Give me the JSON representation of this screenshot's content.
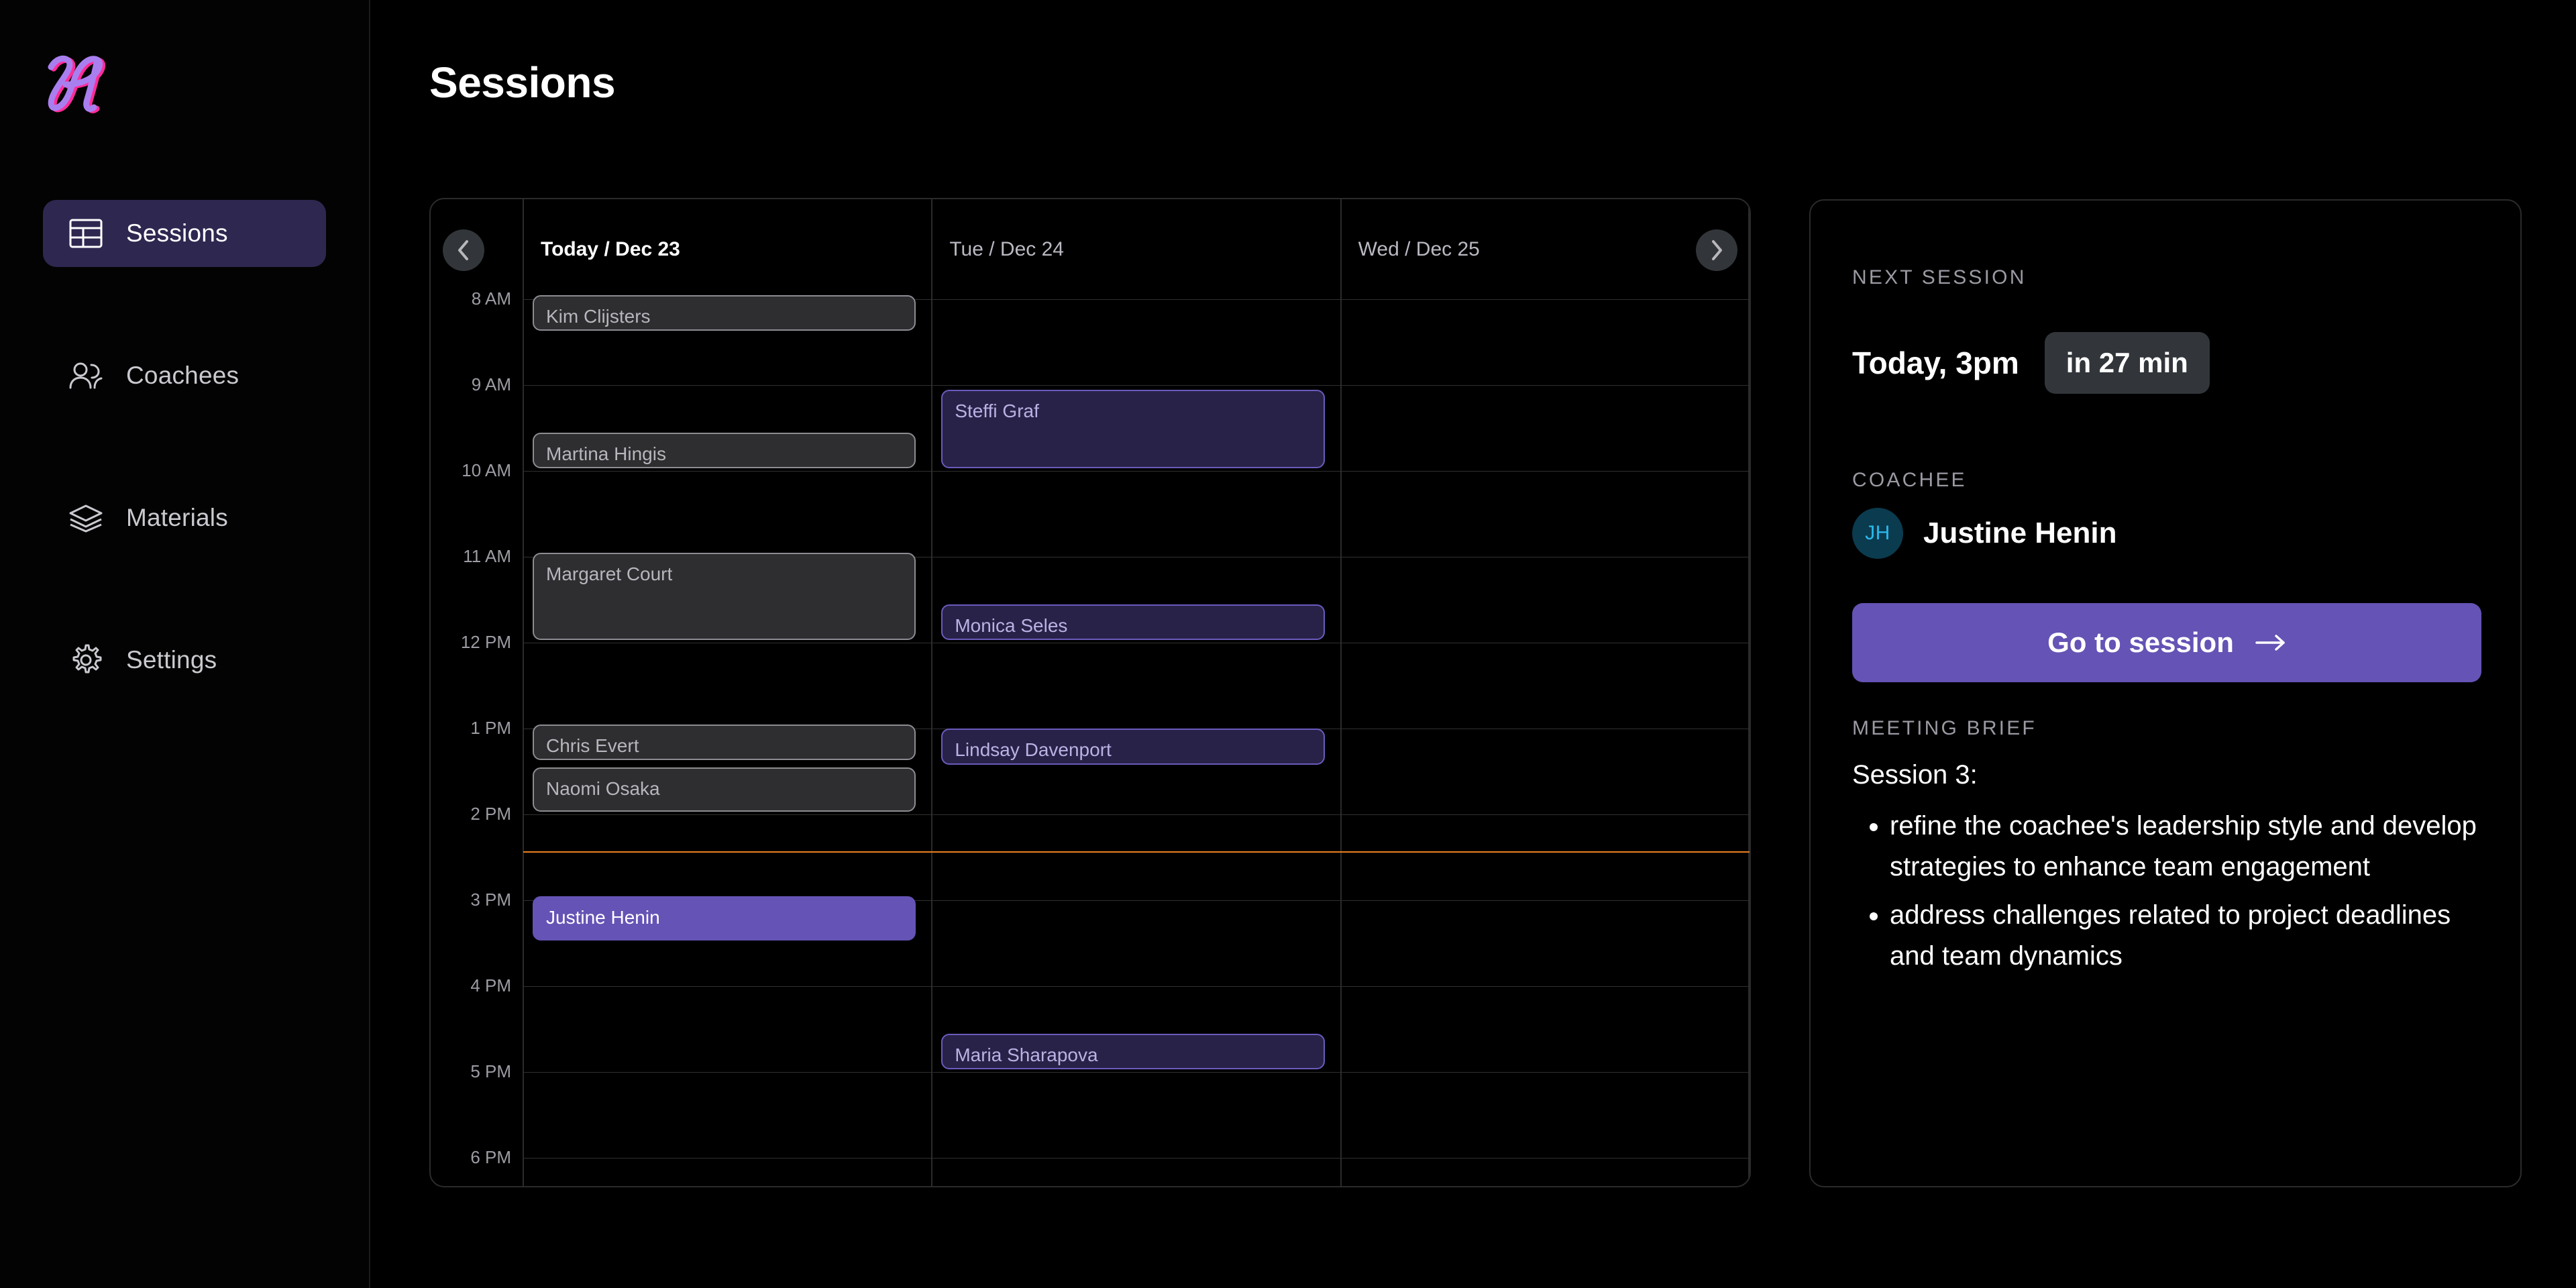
{
  "app": {
    "logo_letter": "H",
    "logo_color": "#a97ff0",
    "logo_shadow_color": "#ff2d9b"
  },
  "sidebar": {
    "items": [
      {
        "label": "Sessions",
        "icon": "table-icon",
        "active": true
      },
      {
        "label": "Coachees",
        "icon": "users-icon",
        "active": false
      },
      {
        "label": "Materials",
        "icon": "layers-icon",
        "active": false
      },
      {
        "label": "Settings",
        "icon": "gear-icon",
        "active": false
      }
    ]
  },
  "header": {
    "title": "Sessions"
  },
  "calendar": {
    "prev_icon": "chevron-left-icon",
    "next_icon": "chevron-right-icon",
    "days": [
      {
        "label": "Today / Dec 23",
        "today": true
      },
      {
        "label": "Tue  / Dec 24",
        "today": false
      },
      {
        "label": "Wed / Dec 25",
        "today": false
      }
    ],
    "hours": [
      "8 AM",
      "9 AM",
      "10 AM",
      "11 AM",
      "12 PM",
      "1 PM",
      "2 PM",
      "3 PM",
      "4 PM",
      "5 PM",
      "6 PM"
    ],
    "now_line_color": "#e8801f",
    "now_line_time": "2:26 PM",
    "events": [
      {
        "name": "Kim Clijsters",
        "day": 0,
        "start": 8.0,
        "end": 8.4,
        "style": "grey"
      },
      {
        "name": "Martina Hingis",
        "day": 0,
        "start": 9.6,
        "end": 10.0,
        "style": "grey"
      },
      {
        "name": "Margaret Court",
        "day": 0,
        "start": 11.0,
        "end": 12.0,
        "style": "grey"
      },
      {
        "name": "Chris Evert",
        "day": 0,
        "start": 13.0,
        "end": 13.4,
        "style": "grey"
      },
      {
        "name": "Naomi Osaka",
        "day": 0,
        "start": 13.5,
        "end": 14.0,
        "style": "grey"
      },
      {
        "name": "Justine Henin",
        "day": 0,
        "start": 15.0,
        "end": 15.5,
        "style": "filled"
      },
      {
        "name": "Steffi Graf",
        "day": 1,
        "start": 9.1,
        "end": 10.0,
        "style": "indigo"
      },
      {
        "name": "Monica Seles",
        "day": 1,
        "start": 11.6,
        "end": 12.0,
        "style": "indigo"
      },
      {
        "name": "Lindsay Davenport",
        "day": 1,
        "start": 13.05,
        "end": 13.45,
        "style": "indigo"
      },
      {
        "name": "Maria Sharapova",
        "day": 1,
        "start": 16.6,
        "end": 17.0,
        "style": "indigo"
      }
    ]
  },
  "panel": {
    "next_session_label": "NEXT SESSION",
    "next_session_time": "Today, 3pm",
    "next_session_countdown": "in 27 min",
    "coachee_label": "COACHEE",
    "coachee_initials": "JH",
    "coachee_name": "Justine Henin",
    "go_to_session_label": "Go to session",
    "go_to_session_icon": "arrow-right-icon",
    "brief_label": "MEETING BRIEF",
    "brief_intro": "Session 3:",
    "brief_bullets": [
      "refine the coachee's leadership style and develop strategies to enhance team engagement",
      "address challenges related to project deadlines and team dynamics"
    ]
  }
}
